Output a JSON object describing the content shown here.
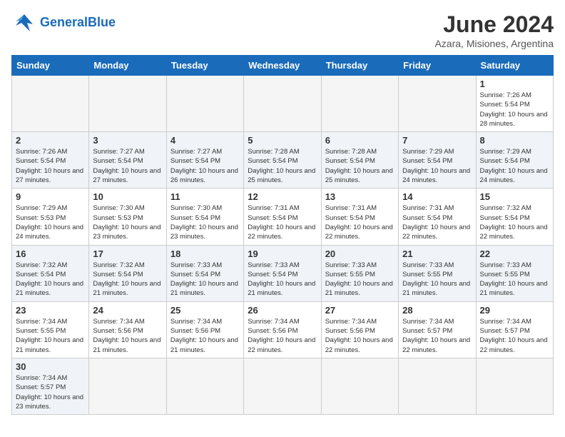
{
  "header": {
    "logo_general": "General",
    "logo_blue": "Blue",
    "month_year": "June 2024",
    "location": "Azara, Misiones, Argentina"
  },
  "days_of_week": [
    "Sunday",
    "Monday",
    "Tuesday",
    "Wednesday",
    "Thursday",
    "Friday",
    "Saturday"
  ],
  "weeks": [
    {
      "days": [
        {
          "date": null
        },
        {
          "date": null
        },
        {
          "date": null
        },
        {
          "date": null
        },
        {
          "date": null
        },
        {
          "date": null
        },
        {
          "date": "1",
          "sunrise": "7:26 AM",
          "sunset": "5:54 PM",
          "daylight": "10 hours and 28 minutes."
        }
      ]
    },
    {
      "days": [
        {
          "date": "2",
          "sunrise": "7:26 AM",
          "sunset": "5:54 PM",
          "daylight": "10 hours and 27 minutes."
        },
        {
          "date": "3",
          "sunrise": "7:27 AM",
          "sunset": "5:54 PM",
          "daylight": "10 hours and 27 minutes."
        },
        {
          "date": "4",
          "sunrise": "7:27 AM",
          "sunset": "5:54 PM",
          "daylight": "10 hours and 26 minutes."
        },
        {
          "date": "5",
          "sunrise": "7:28 AM",
          "sunset": "5:54 PM",
          "daylight": "10 hours and 25 minutes."
        },
        {
          "date": "6",
          "sunrise": "7:28 AM",
          "sunset": "5:54 PM",
          "daylight": "10 hours and 25 minutes."
        },
        {
          "date": "7",
          "sunrise": "7:29 AM",
          "sunset": "5:54 PM",
          "daylight": "10 hours and 24 minutes."
        },
        {
          "date": "8",
          "sunrise": "7:29 AM",
          "sunset": "5:54 PM",
          "daylight": "10 hours and 24 minutes."
        }
      ]
    },
    {
      "days": [
        {
          "date": "9",
          "sunrise": "7:29 AM",
          "sunset": "5:53 PM",
          "daylight": "10 hours and 24 minutes."
        },
        {
          "date": "10",
          "sunrise": "7:30 AM",
          "sunset": "5:53 PM",
          "daylight": "10 hours and 23 minutes."
        },
        {
          "date": "11",
          "sunrise": "7:30 AM",
          "sunset": "5:54 PM",
          "daylight": "10 hours and 23 minutes."
        },
        {
          "date": "12",
          "sunrise": "7:31 AM",
          "sunset": "5:54 PM",
          "daylight": "10 hours and 22 minutes."
        },
        {
          "date": "13",
          "sunrise": "7:31 AM",
          "sunset": "5:54 PM",
          "daylight": "10 hours and 22 minutes."
        },
        {
          "date": "14",
          "sunrise": "7:31 AM",
          "sunset": "5:54 PM",
          "daylight": "10 hours and 22 minutes."
        },
        {
          "date": "15",
          "sunrise": "7:32 AM",
          "sunset": "5:54 PM",
          "daylight": "10 hours and 22 minutes."
        }
      ]
    },
    {
      "days": [
        {
          "date": "16",
          "sunrise": "7:32 AM",
          "sunset": "5:54 PM",
          "daylight": "10 hours and 21 minutes."
        },
        {
          "date": "17",
          "sunrise": "7:32 AM",
          "sunset": "5:54 PM",
          "daylight": "10 hours and 21 minutes."
        },
        {
          "date": "18",
          "sunrise": "7:33 AM",
          "sunset": "5:54 PM",
          "daylight": "10 hours and 21 minutes."
        },
        {
          "date": "19",
          "sunrise": "7:33 AM",
          "sunset": "5:54 PM",
          "daylight": "10 hours and 21 minutes."
        },
        {
          "date": "20",
          "sunrise": "7:33 AM",
          "sunset": "5:55 PM",
          "daylight": "10 hours and 21 minutes."
        },
        {
          "date": "21",
          "sunrise": "7:33 AM",
          "sunset": "5:55 PM",
          "daylight": "10 hours and 21 minutes."
        },
        {
          "date": "22",
          "sunrise": "7:33 AM",
          "sunset": "5:55 PM",
          "daylight": "10 hours and 21 minutes."
        }
      ]
    },
    {
      "days": [
        {
          "date": "23",
          "sunrise": "7:34 AM",
          "sunset": "5:55 PM",
          "daylight": "10 hours and 21 minutes."
        },
        {
          "date": "24",
          "sunrise": "7:34 AM",
          "sunset": "5:56 PM",
          "daylight": "10 hours and 21 minutes."
        },
        {
          "date": "25",
          "sunrise": "7:34 AM",
          "sunset": "5:56 PM",
          "daylight": "10 hours and 21 minutes."
        },
        {
          "date": "26",
          "sunrise": "7:34 AM",
          "sunset": "5:56 PM",
          "daylight": "10 hours and 22 minutes."
        },
        {
          "date": "27",
          "sunrise": "7:34 AM",
          "sunset": "5:56 PM",
          "daylight": "10 hours and 22 minutes."
        },
        {
          "date": "28",
          "sunrise": "7:34 AM",
          "sunset": "5:57 PM",
          "daylight": "10 hours and 22 minutes."
        },
        {
          "date": "29",
          "sunrise": "7:34 AM",
          "sunset": "5:57 PM",
          "daylight": "10 hours and 22 minutes."
        }
      ]
    },
    {
      "days": [
        {
          "date": "30",
          "sunrise": "7:34 AM",
          "sunset": "5:57 PM",
          "daylight": "10 hours and 23 minutes."
        },
        {
          "date": null
        },
        {
          "date": null
        },
        {
          "date": null
        },
        {
          "date": null
        },
        {
          "date": null
        },
        {
          "date": null
        }
      ]
    }
  ]
}
